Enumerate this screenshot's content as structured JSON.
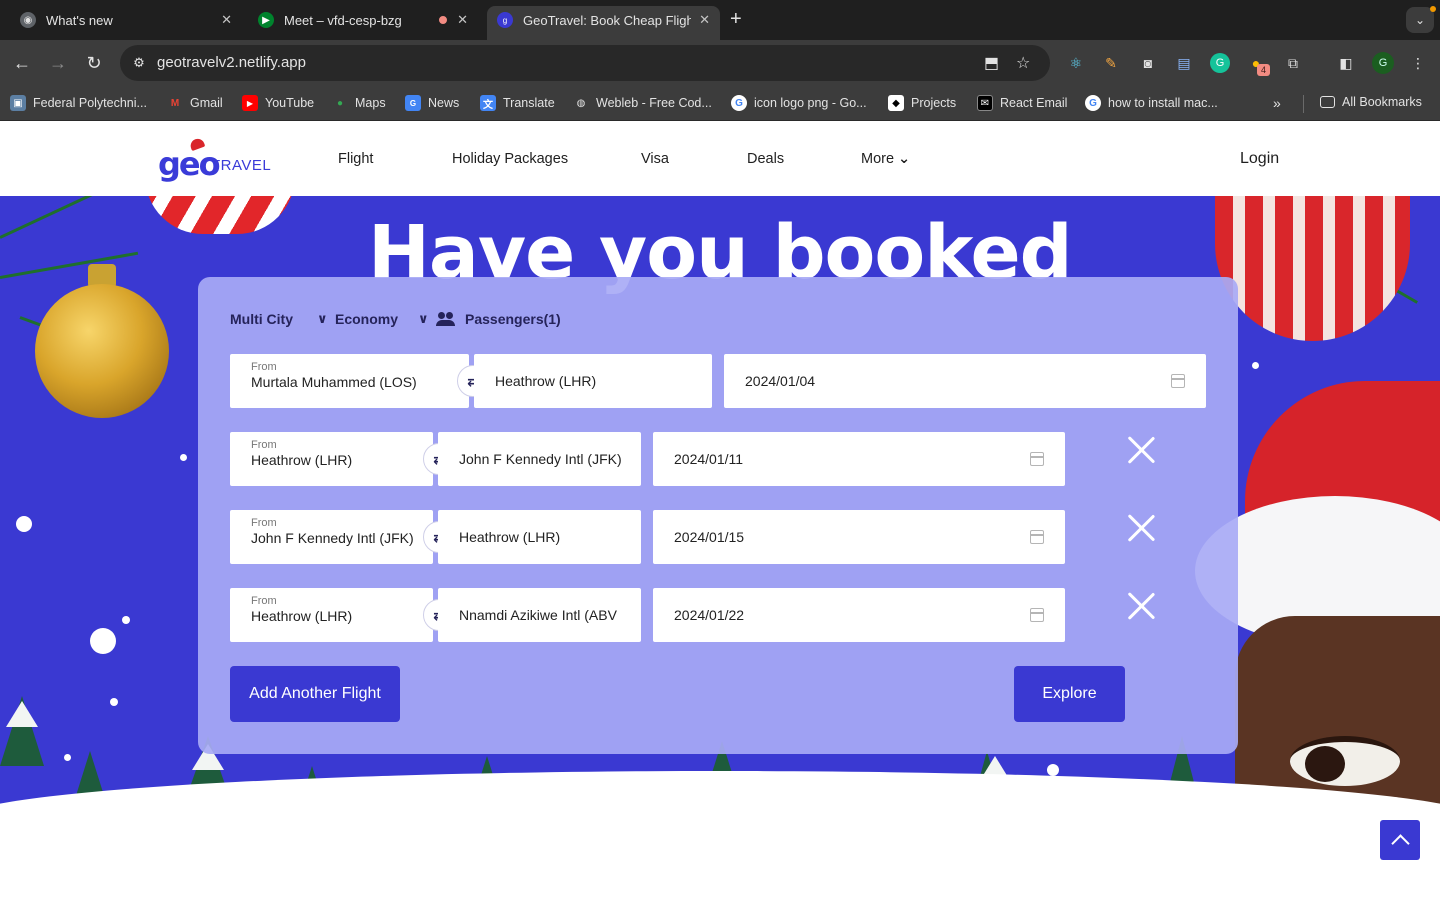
{
  "browser": {
    "tabs": [
      {
        "title": "What's new",
        "active": false
      },
      {
        "title": "Meet – vfd-cesp-bzg",
        "active": false
      },
      {
        "title": "GeoTravel: Book Cheap Flight",
        "active": true
      }
    ],
    "url": "geotravelv2.netlify.app",
    "profile_initial": "G",
    "extension_badge": "4",
    "bookmarks": [
      "Federal Polytechni...",
      "Gmail",
      "YouTube",
      "Maps",
      "News",
      "Translate",
      "Webleb - Free Cod...",
      "icon logo png - Go...",
      "Projects",
      "React Email",
      "how to install mac..."
    ],
    "all_bookmarks": "All Bookmarks"
  },
  "site": {
    "logo": {
      "geo": "geo",
      "travel": "TRAVEL"
    },
    "nav": [
      "Flight",
      "Holiday Packages",
      "Visa",
      "Deals",
      "More"
    ],
    "login": "Login",
    "hero_title": "Have you booked"
  },
  "booking": {
    "trip_type": "Multi City",
    "cabin_class": "Economy",
    "passengers": "Passengers(1)",
    "from_label": "From",
    "legs": [
      {
        "from": "Murtala Muhammed (LOS)",
        "to": "Heathrow (LHR)",
        "date": "2024/01/04",
        "removable": false
      },
      {
        "from": "Heathrow (LHR)",
        "to": "John F Kennedy Intl (JFK)",
        "date": "2024/01/11",
        "removable": true
      },
      {
        "from": "John F Kennedy Intl (JFK)",
        "to": "Heathrow (LHR)",
        "date": "2024/01/15",
        "removable": true
      },
      {
        "from": "Heathrow (LHR)",
        "to": "Nnamdi Azikiwe Intl (ABV",
        "date": "2024/01/22",
        "removable": true
      }
    ],
    "add_flight": "Add Another Flight",
    "explore": "Explore"
  },
  "colors": {
    "brand": "#3a39d2",
    "card": "#a8aaf5",
    "chrome_dark": "#1f1f1f",
    "chrome_toolbar": "#3c3c3c"
  }
}
